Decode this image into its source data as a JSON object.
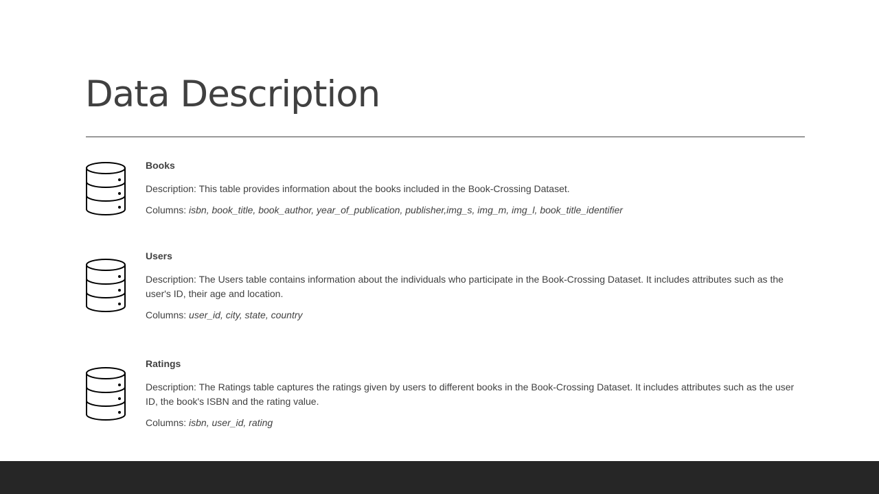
{
  "slide": {
    "title": "Data Description"
  },
  "sections": [
    {
      "heading": "Books",
      "description_prefix": "Description: ",
      "description": "This table provides information about the books included in the Book-Crossing Dataset.",
      "columns_prefix": "Columns: ",
      "columns": "isbn, book_title, book_author,  year_of_publication, publisher,img_s, img_m, img_l, book_title_identifier",
      "icon": "database-icon"
    },
    {
      "heading": "Users",
      "description_prefix": "Description: ",
      "description": "The Users table contains information about the individuals who participate in the Book-Crossing Dataset. It includes attributes such as the user's ID, their age and location.",
      "columns_prefix": "Columns: ",
      "columns": "user_id, city, state, country",
      "icon": "database-icon"
    },
    {
      "heading": "Ratings",
      "description_prefix": "Description: ",
      "description": "The Ratings table captures the ratings given by users to different books in the Book-Crossing Dataset. It includes attributes such as the user ID, the book's ISBN and the rating value.",
      "columns_prefix": "Columns: ",
      "columns": "isbn, user_id, rating",
      "icon": "database-icon"
    }
  ],
  "colors": {
    "text": "#404040",
    "footer": "#262626",
    "background": "#ffffff"
  }
}
